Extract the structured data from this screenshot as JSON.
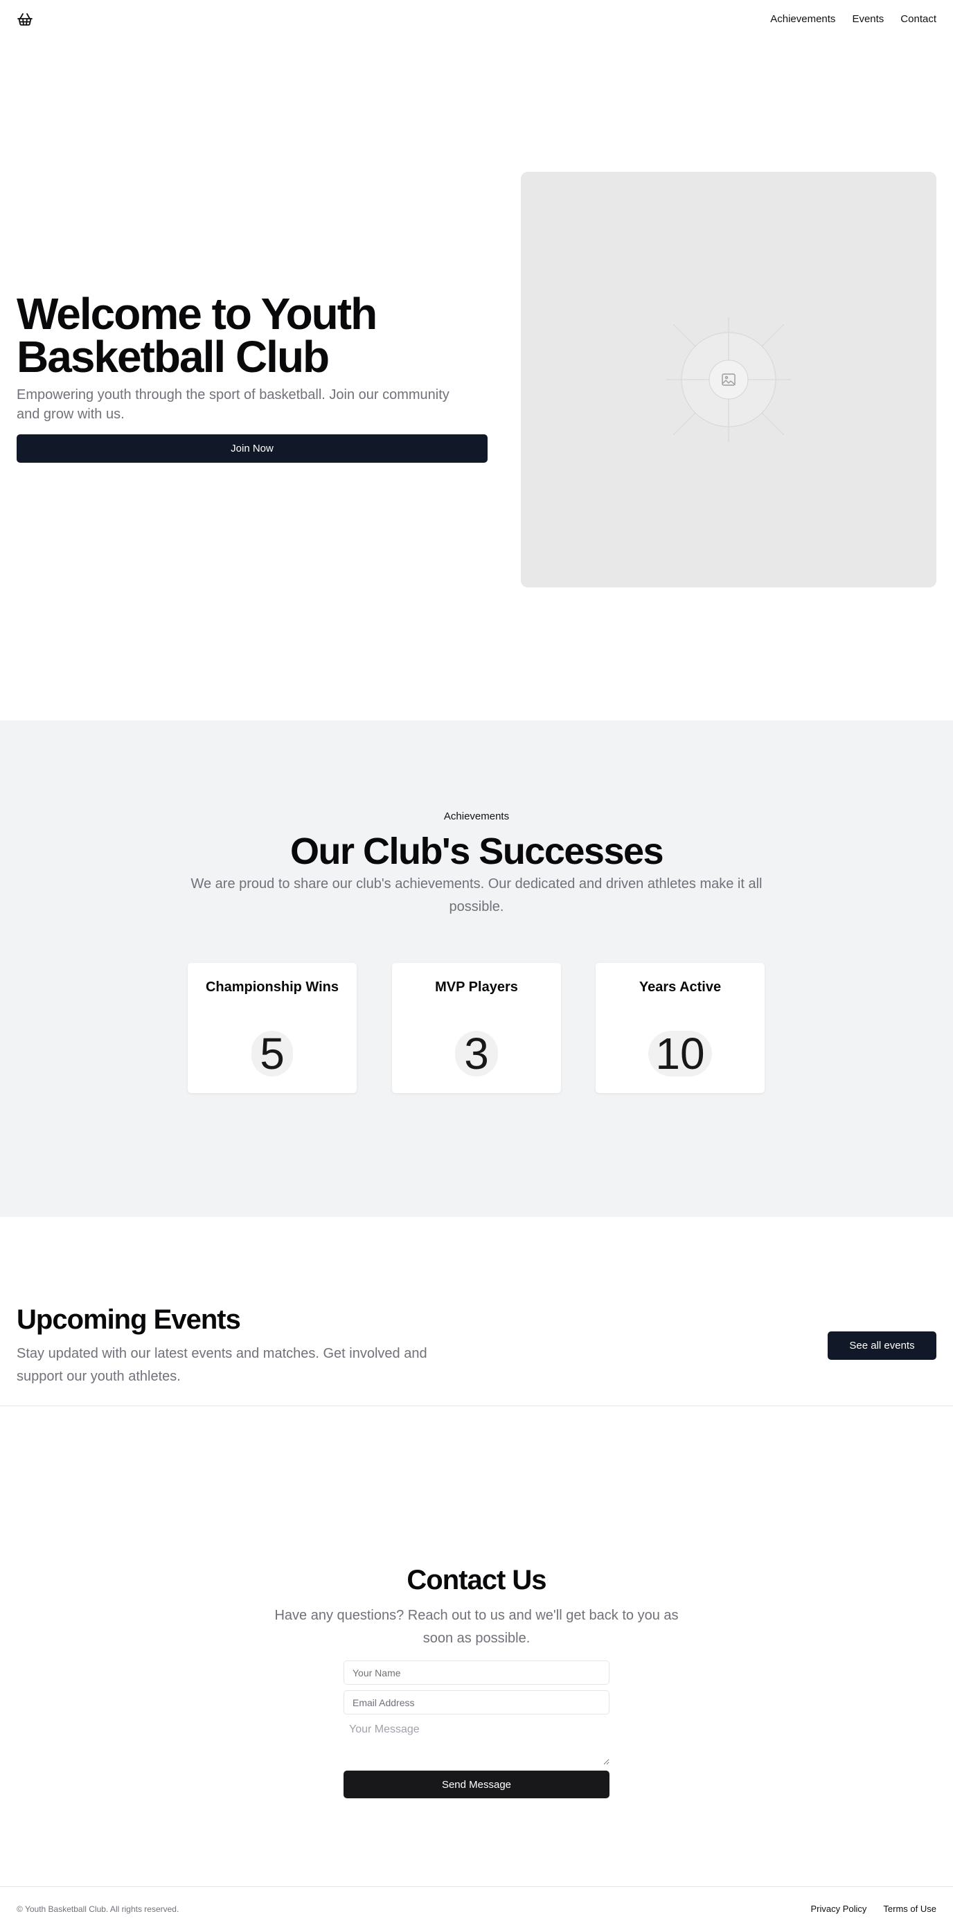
{
  "header": {
    "logo_icon": "basket-icon",
    "nav": [
      {
        "label": "Achievements"
      },
      {
        "label": "Events"
      },
      {
        "label": "Contact"
      }
    ]
  },
  "hero": {
    "title": "Welcome to Youth Basketball Club",
    "subtitle": "Empowering youth through the sport of basketball. Join our community and grow with us.",
    "cta": "Join Now",
    "image_icon": "image-placeholder-icon"
  },
  "achievements": {
    "tag": "Achievements",
    "title": "Our Club's Successes",
    "subtitle": "We are proud to share our club's achievements. Our dedicated and driven athletes make it all possible.",
    "cards": [
      {
        "title": "Championship Wins",
        "value": "5"
      },
      {
        "title": "MVP Players",
        "value": "3"
      },
      {
        "title": "Years Active",
        "value": "10"
      }
    ]
  },
  "events": {
    "title": "Upcoming Events",
    "subtitle": "Stay updated with our latest events and matches. Get involved and support our youth athletes.",
    "cta": "See all events"
  },
  "contact": {
    "title": "Contact Us",
    "subtitle": "Have any questions? Reach out to us and we'll get back to you as soon as possible.",
    "name_placeholder": "Your Name",
    "email_placeholder": "Email Address",
    "message_placeholder": "Your Message",
    "submit": "Send Message"
  },
  "footer": {
    "copyright": "© Youth Basketball Club. All rights reserved.",
    "links": [
      {
        "label": "Privacy Policy"
      },
      {
        "label": "Terms of Use"
      }
    ]
  },
  "colors": {
    "primary_button": "#111827",
    "send_button": "#18181b",
    "muted_text": "#71717a",
    "section_bg": "#f2f3f5",
    "image_placeholder_bg": "#e8e8e8"
  }
}
